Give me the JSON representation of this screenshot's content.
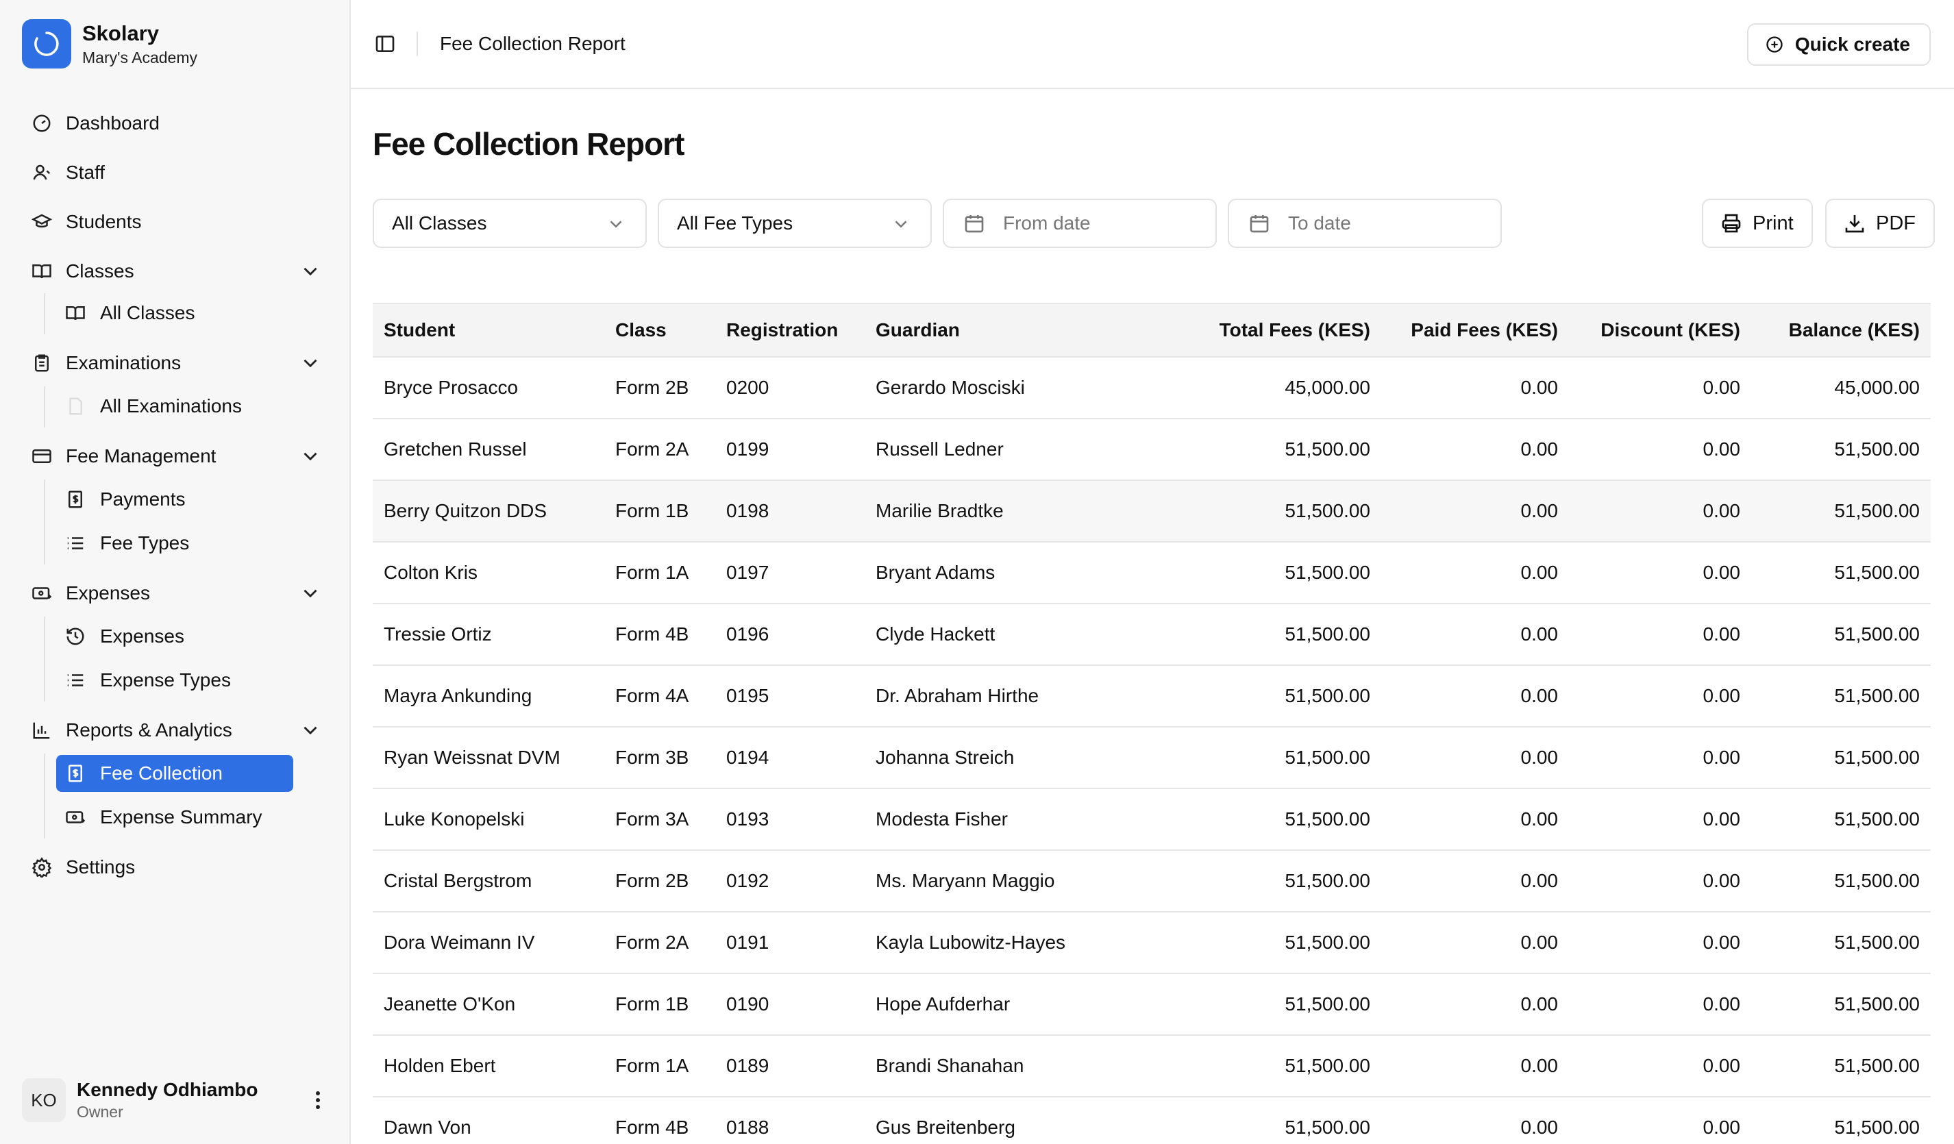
{
  "brand": {
    "name": "Skolary",
    "school": "Mary's Academy"
  },
  "nav": {
    "dashboard": "Dashboard",
    "staff": "Staff",
    "students": "Students",
    "classes": "Classes",
    "all_classes": "All Classes",
    "examinations": "Examinations",
    "all_examinations": "All Examinations",
    "fee_management": "Fee Management",
    "payments": "Payments",
    "fee_types": "Fee Types",
    "expenses_group": "Expenses",
    "expenses": "Expenses",
    "expense_types": "Expense Types",
    "reports": "Reports & Analytics",
    "fee_collection": "Fee Collection",
    "expense_summary": "Expense Summary",
    "settings": "Settings"
  },
  "user": {
    "initials": "KO",
    "name": "Kennedy Odhiambo",
    "role": "Owner"
  },
  "header": {
    "title": "Fee Collection Report",
    "quick_create": "Quick create"
  },
  "page": {
    "title": "Fee Collection Report"
  },
  "filters": {
    "class": "All Classes",
    "fee_type": "All Fee Types",
    "from_placeholder": "From date",
    "to_placeholder": "To date"
  },
  "actions": {
    "print": "Print",
    "pdf": "PDF"
  },
  "table": {
    "columns": {
      "student": "Student",
      "class": "Class",
      "registration": "Registration",
      "guardian": "Guardian",
      "total": "Total Fees (KES)",
      "paid": "Paid Fees (KES)",
      "discount": "Discount (KES)",
      "balance": "Balance (KES)"
    },
    "rows": [
      {
        "student": "Bryce Prosacco",
        "class": "Form 2B",
        "registration": "0200",
        "guardian": "Gerardo Mosciski",
        "total": "45,000.00",
        "paid": "0.00",
        "discount": "0.00",
        "balance": "45,000.00"
      },
      {
        "student": "Gretchen Russel",
        "class": "Form 2A",
        "registration": "0199",
        "guardian": "Russell Ledner",
        "total": "51,500.00",
        "paid": "0.00",
        "discount": "0.00",
        "balance": "51,500.00"
      },
      {
        "student": "Berry Quitzon DDS",
        "class": "Form 1B",
        "registration": "0198",
        "guardian": "Marilie Bradtke",
        "total": "51,500.00",
        "paid": "0.00",
        "discount": "0.00",
        "balance": "51,500.00"
      },
      {
        "student": "Colton Kris",
        "class": "Form 1A",
        "registration": "0197",
        "guardian": "Bryant Adams",
        "total": "51,500.00",
        "paid": "0.00",
        "discount": "0.00",
        "balance": "51,500.00"
      },
      {
        "student": "Tressie Ortiz",
        "class": "Form 4B",
        "registration": "0196",
        "guardian": "Clyde Hackett",
        "total": "51,500.00",
        "paid": "0.00",
        "discount": "0.00",
        "balance": "51,500.00"
      },
      {
        "student": "Mayra Ankunding",
        "class": "Form 4A",
        "registration": "0195",
        "guardian": "Dr. Abraham Hirthe",
        "total": "51,500.00",
        "paid": "0.00",
        "discount": "0.00",
        "balance": "51,500.00"
      },
      {
        "student": "Ryan Weissnat DVM",
        "class": "Form 3B",
        "registration": "0194",
        "guardian": "Johanna Streich",
        "total": "51,500.00",
        "paid": "0.00",
        "discount": "0.00",
        "balance": "51,500.00"
      },
      {
        "student": "Luke Konopelski",
        "class": "Form 3A",
        "registration": "0193",
        "guardian": "Modesta Fisher",
        "total": "51,500.00",
        "paid": "0.00",
        "discount": "0.00",
        "balance": "51,500.00"
      },
      {
        "student": "Cristal Bergstrom",
        "class": "Form 2B",
        "registration": "0192",
        "guardian": "Ms. Maryann Maggio",
        "total": "51,500.00",
        "paid": "0.00",
        "discount": "0.00",
        "balance": "51,500.00"
      },
      {
        "student": "Dora Weimann IV",
        "class": "Form 2A",
        "registration": "0191",
        "guardian": "Kayla Lubowitz-Hayes",
        "total": "51,500.00",
        "paid": "0.00",
        "discount": "0.00",
        "balance": "51,500.00"
      },
      {
        "student": "Jeanette O'Kon",
        "class": "Form 1B",
        "registration": "0190",
        "guardian": "Hope Aufderhar",
        "total": "51,500.00",
        "paid": "0.00",
        "discount": "0.00",
        "balance": "51,500.00"
      },
      {
        "student": "Holden Ebert",
        "class": "Form 1A",
        "registration": "0189",
        "guardian": "Brandi Shanahan",
        "total": "51,500.00",
        "paid": "0.00",
        "discount": "0.00",
        "balance": "51,500.00"
      },
      {
        "student": "Dawn Von",
        "class": "Form 4B",
        "registration": "0188",
        "guardian": "Gus Breitenberg",
        "total": "51,500.00",
        "paid": "0.00",
        "discount": "0.00",
        "balance": "51,500.00"
      }
    ]
  },
  "colors": {
    "accent": "#2f6fe4",
    "sidebar_bg": "#f7f7f7",
    "border": "#e6e6e6"
  }
}
